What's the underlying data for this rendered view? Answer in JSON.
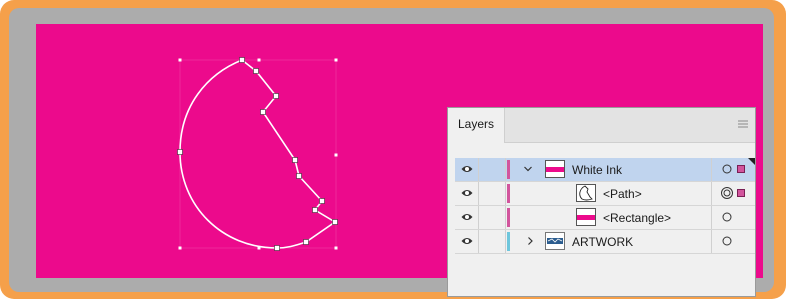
{
  "colors": {
    "frame_border": "#f5a04a",
    "canvas_background": "#acacac",
    "artboard_fill": "#ec0a8c",
    "selection_color": "#c0d4ee",
    "white_ink_layer_color": "#d2559d",
    "artwork_layer_color": "#6ec6dc"
  },
  "layers_panel": {
    "tab_label": "Layers",
    "menu_icon": "hamburger-menu-icon",
    "rows": [
      {
        "label": "White Ink",
        "type": "layer",
        "expanded": true,
        "selected": true,
        "visible": true,
        "thumbnail": "pink-stripe-thumbnail",
        "target": "circle-icon",
        "has_selection": true
      },
      {
        "label": "<Path>",
        "type": "sublayer",
        "visible": true,
        "thumbnail": "path-outline-thumbnail",
        "target": "double-circle-icon",
        "has_selection": true
      },
      {
        "label": "<Rectangle>",
        "type": "sublayer",
        "visible": true,
        "thumbnail": "pink-stripe-thumbnail",
        "target": "circle-icon",
        "has_selection": false
      },
      {
        "label": "ARTWORK",
        "type": "layer",
        "expanded": false,
        "visible": true,
        "thumbnail": "artwork-thumbnail",
        "target": "circle-icon",
        "has_selection": false
      }
    ]
  }
}
